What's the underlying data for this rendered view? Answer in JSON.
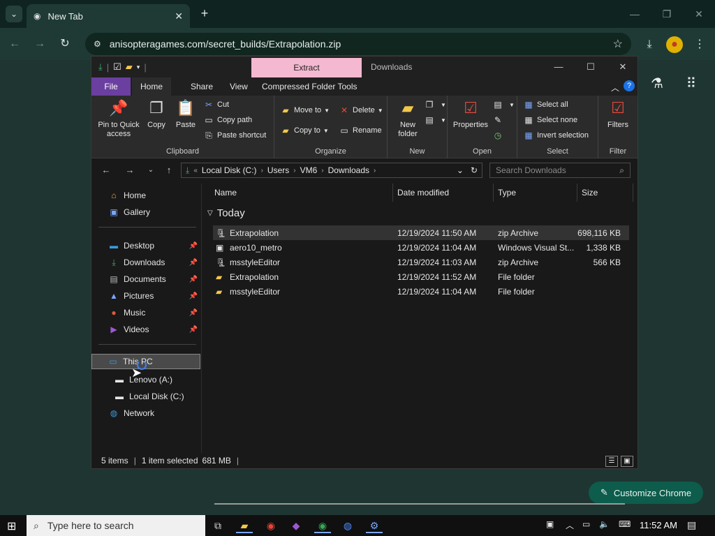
{
  "chrome": {
    "tab_title": "New Tab",
    "url": "anisopteragames.com/secret_builds/Extrapolation.zip",
    "customize_label": "Customize Chrome"
  },
  "explorer": {
    "context_tab": "Extract",
    "window_title": "Downloads",
    "ribbon_tabs": [
      "File",
      "Home",
      "Share",
      "View",
      "Compressed Folder Tools"
    ],
    "clipboard": {
      "pin": "Pin to Quick access",
      "copy": "Copy",
      "paste": "Paste",
      "cut": "Cut",
      "copy_path": "Copy path",
      "paste_shortcut": "Paste shortcut",
      "label": "Clipboard"
    },
    "organize": {
      "move_to": "Move to",
      "copy_to": "Copy to",
      "delete": "Delete",
      "rename": "Rename",
      "label": "Organize"
    },
    "new": {
      "new_folder": "New folder",
      "label": "New"
    },
    "open": {
      "properties": "Properties",
      "label": "Open"
    },
    "select": {
      "select_all": "Select all",
      "select_none": "Select none",
      "invert": "Invert selection",
      "label": "Select"
    },
    "filter": {
      "filters": "Filters",
      "label": "Filter"
    },
    "address": {
      "crumbs": [
        "Local Disk (C:)",
        "Users",
        "VM6",
        "Downloads"
      ]
    },
    "search_placeholder": "Search Downloads",
    "nav": {
      "home": "Home",
      "gallery": "Gallery",
      "desktop": "Desktop",
      "downloads": "Downloads",
      "documents": "Documents",
      "pictures": "Pictures",
      "music": "Music",
      "videos": "Videos",
      "this_pc": "This PC",
      "lenovo": "Lenovo (A:)",
      "local_disk": "Local Disk (C:)",
      "network": "Network"
    },
    "columns": {
      "name": "Name",
      "date": "Date modified",
      "type": "Type",
      "size": "Size"
    },
    "group": "Today",
    "files": [
      {
        "name": "Extrapolation",
        "date": "12/19/2024 11:50 AM",
        "type": "zip Archive",
        "size": "698,116 KB"
      },
      {
        "name": "aero10_metro",
        "date": "12/19/2024 11:04 AM",
        "type": "Windows Visual St...",
        "size": "1,338 KB"
      },
      {
        "name": "msstyleEditor",
        "date": "12/19/2024 11:03 AM",
        "type": "zip Archive",
        "size": "566 KB"
      },
      {
        "name": "Extrapolation",
        "date": "12/19/2024 11:52 AM",
        "type": "File folder",
        "size": ""
      },
      {
        "name": "msstyleEditor",
        "date": "12/19/2024 11:04 AM",
        "type": "File folder",
        "size": ""
      }
    ],
    "status": {
      "items": "5 items",
      "selected": "1 item selected",
      "size": "681 MB"
    }
  },
  "taskbar": {
    "search_placeholder": "Type here to search",
    "time": "11:52 AM"
  },
  "colors": {
    "accent_file_tab": "#6b3fa0",
    "context_tab": "#f4b8d0",
    "chrome_bg": "#1f3531"
  }
}
